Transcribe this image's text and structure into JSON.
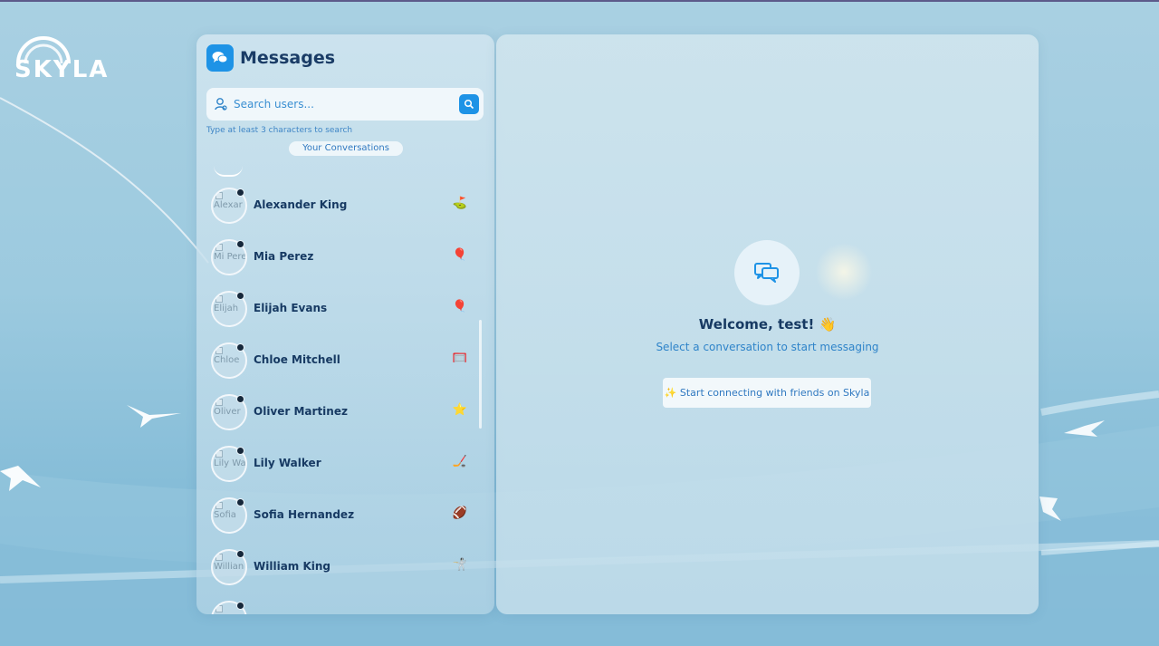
{
  "brand": {
    "name": "SKYLA"
  },
  "sidebar": {
    "title": "Messages",
    "search": {
      "placeholder": "Search users...",
      "hint": "Type at least 3 characters to search"
    },
    "conversations_label": "Your Conversations",
    "conversations": [
      {
        "name": "Alexander King",
        "alt": "Alexar",
        "emoji": "⛳"
      },
      {
        "name": "Mia Perez",
        "alt": "Mi Perez",
        "emoji": "🎈"
      },
      {
        "name": "Elijah Evans",
        "alt": "Elijah",
        "emoji": "🎈"
      },
      {
        "name": "Chloe Mitchell",
        "alt": "Chloe",
        "emoji": "🥅"
      },
      {
        "name": "Oliver Martinez",
        "alt": "Oliver",
        "emoji": "⭐"
      },
      {
        "name": "Lily Walker",
        "alt": "Lily Walke",
        "emoji": "🏒"
      },
      {
        "name": "Sofia Hernandez",
        "alt": "Sofia",
        "emoji": "🏈"
      },
      {
        "name": "William King",
        "alt": "Willian",
        "emoji": "🤺"
      }
    ]
  },
  "main": {
    "welcome_title": "Welcome, test! 👋",
    "welcome_subtitle": "Select a conversation to start messaging",
    "connect_label": "✨ Start connecting with friends on Skyla"
  },
  "icons": {
    "messages": "chat-bubbles-icon",
    "search_user": "user-search-icon",
    "search": "magnifier-icon",
    "welcome": "chat-bubbles-icon"
  },
  "colors": {
    "accent": "#1e93e6",
    "title": "#173a63",
    "link": "#2f84c9"
  }
}
